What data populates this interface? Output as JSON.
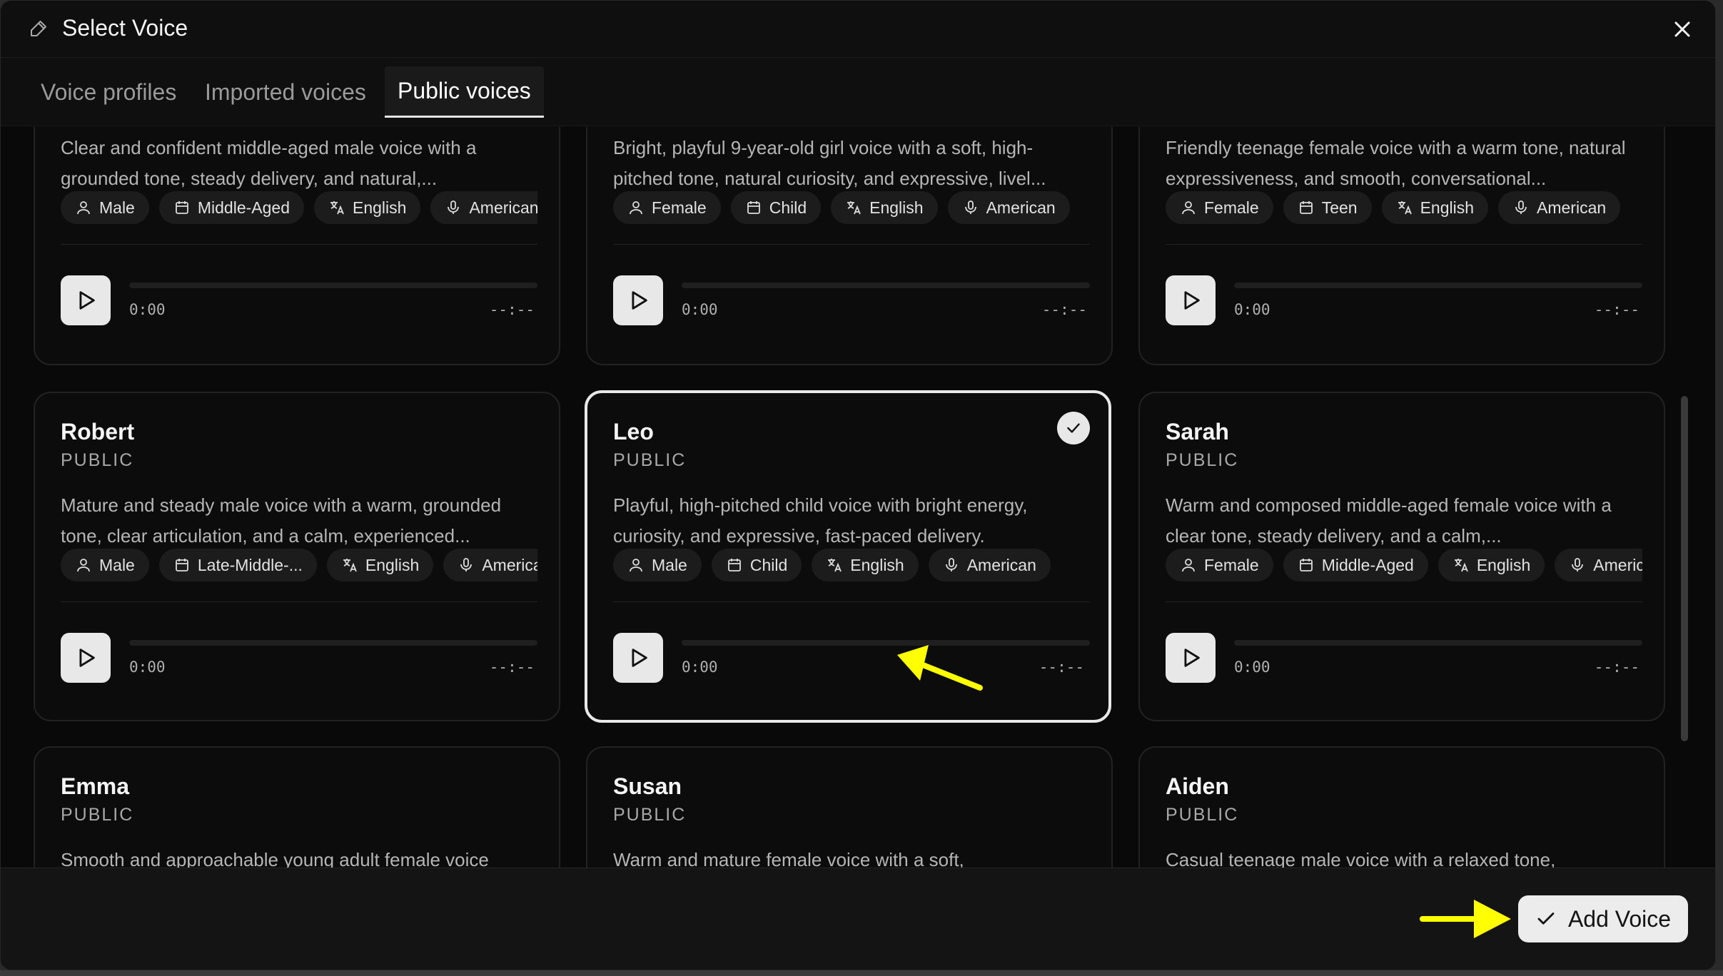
{
  "header": {
    "title": "Select Voice"
  },
  "tabs": [
    {
      "label": "Voice profiles",
      "active": false
    },
    {
      "label": "Imported voices",
      "active": false
    },
    {
      "label": "Public voices",
      "active": true
    }
  ],
  "cards": [
    {
      "desc": "Clear and confident middle-aged male voice with a grounded tone, steady delivery, and natural,...",
      "tags": [
        "Male",
        "Middle-Aged",
        "English",
        "American"
      ],
      "time": "0:00",
      "duration": "--:--"
    },
    {
      "desc": "Bright, playful 9-year-old girl voice with a soft, high-pitched tone, natural curiosity, and expressive, livel...",
      "tags": [
        "Female",
        "Child",
        "English",
        "American"
      ],
      "time": "0:00",
      "duration": "--:--"
    },
    {
      "desc": "Friendly teenage female voice with a warm tone, natural expressiveness, and smooth, conversational...",
      "tags": [
        "Female",
        "Teen",
        "English",
        "American"
      ],
      "time": "0:00",
      "duration": "--:--"
    },
    {
      "name": "Robert",
      "visibility": "PUBLIC",
      "desc": "Mature and steady male voice with a warm, grounded tone, clear articulation, and a calm, experienced...",
      "tags": [
        "Male",
        "Late-Middle-...",
        "English",
        "American"
      ],
      "time": "0:00",
      "duration": "--:--"
    },
    {
      "name": "Leo",
      "visibility": "PUBLIC",
      "selected": true,
      "desc": "Playful, high-pitched child voice with bright energy, curiosity, and expressive, fast-paced delivery.",
      "tags": [
        "Male",
        "Child",
        "English",
        "American"
      ],
      "time": "0:00",
      "duration": "--:--"
    },
    {
      "name": "Sarah",
      "visibility": "PUBLIC",
      "desc": "Warm and composed middle-aged female voice with a clear tone, steady delivery, and a calm,...",
      "tags": [
        "Female",
        "Middle-Aged",
        "English",
        "American"
      ],
      "time": "0:00",
      "duration": "--:--"
    },
    {
      "name": "Emma",
      "visibility": "PUBLIC",
      "desc": "Smooth and approachable young adult female voice"
    },
    {
      "name": "Susan",
      "visibility": "PUBLIC",
      "desc": "Warm and mature female voice with a soft,"
    },
    {
      "name": "Aiden",
      "visibility": "PUBLIC",
      "desc": "Casual teenage male voice with a relaxed tone,"
    }
  ],
  "footer": {
    "add_label": "Add Voice"
  },
  "icons": {
    "tag_icons": [
      "person-icon",
      "calendar-icon",
      "translate-icon",
      "microphone-icon"
    ],
    "annotation_color": "#ffff00"
  }
}
